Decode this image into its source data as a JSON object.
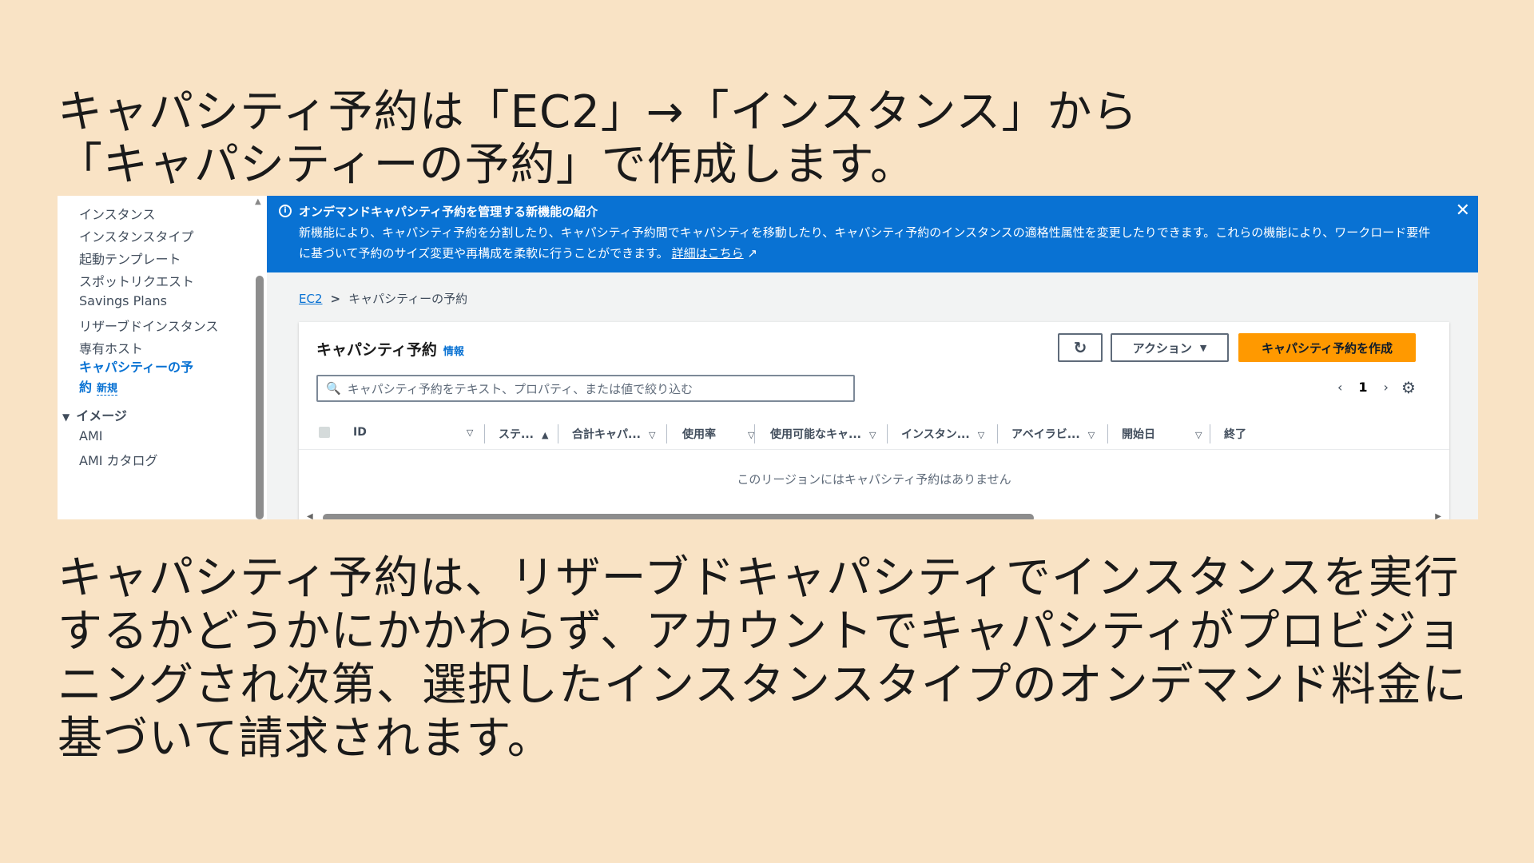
{
  "heading": {
    "lines": [
      "キャパシティ予約は「EC2」→「インスタンス」から",
      "「キャパシティーの予約」で作成します。"
    ]
  },
  "sidebar": {
    "items": [
      {
        "label": "インスタンス"
      },
      {
        "label": "インスタンスタイプ"
      },
      {
        "label": "起動テンプレート"
      },
      {
        "label": "スポットリクエスト"
      },
      {
        "label": "Savings Plans"
      },
      {
        "label": "リザーブドインスタンス"
      },
      {
        "label": "専有ホスト"
      }
    ],
    "active_line1": "キャパシティーの予",
    "active_line2": "約",
    "active_badge": "新規",
    "group": "イメージ",
    "group_items": [
      {
        "label": "AMI"
      },
      {
        "label": "AMI カタログ"
      }
    ]
  },
  "banner": {
    "title": "オンデマンドキャパシティ予約を管理する新機能の紹介",
    "body": "新機能により、キャパシティ予約を分割したり、キャパシティ予約間でキャパシティを移動したり、キャパシティ予約のインスタンスの適格性属性を変更したりできます。これらの機能により、ワークロード要件に基づいて予約のサイズ変更や再構成を柔軟に行うことができます。",
    "link": "詳細はこちら"
  },
  "breadcrumb": {
    "root": "EC2",
    "current": "キャパシティーの予約"
  },
  "panel": {
    "title": "キャパシティ予約",
    "info": "情報",
    "action_label": "アクション",
    "create_label": "キャパシティ予約を作成",
    "search_placeholder": "キャパシティ予約をテキスト、プロパティ、または値で絞り込む",
    "page": "1",
    "columns": [
      "ID",
      "ステ...",
      "合計キャパ...",
      "使用率",
      "使用可能なキャ...",
      "インスタン...",
      "アベイラビ...",
      "開始日",
      "終了"
    ],
    "empty": "このリージョンにはキャパシティ予約はありません"
  },
  "body_text": {
    "lines": [
      "キャパシティ予約は、リザーブドキャパシティでインスタンスを実行",
      "するかどうかにかかわらず、アカウントでキャパシティがプロビジョ",
      "ニングされ次第、選択したインスタンスタイプのオンデマンド料金に",
      "基づいて請求されます。"
    ]
  },
  "colors": {
    "background": "#f9e3c5",
    "banner": "#0972d3",
    "primary_button": "#ff9900"
  }
}
